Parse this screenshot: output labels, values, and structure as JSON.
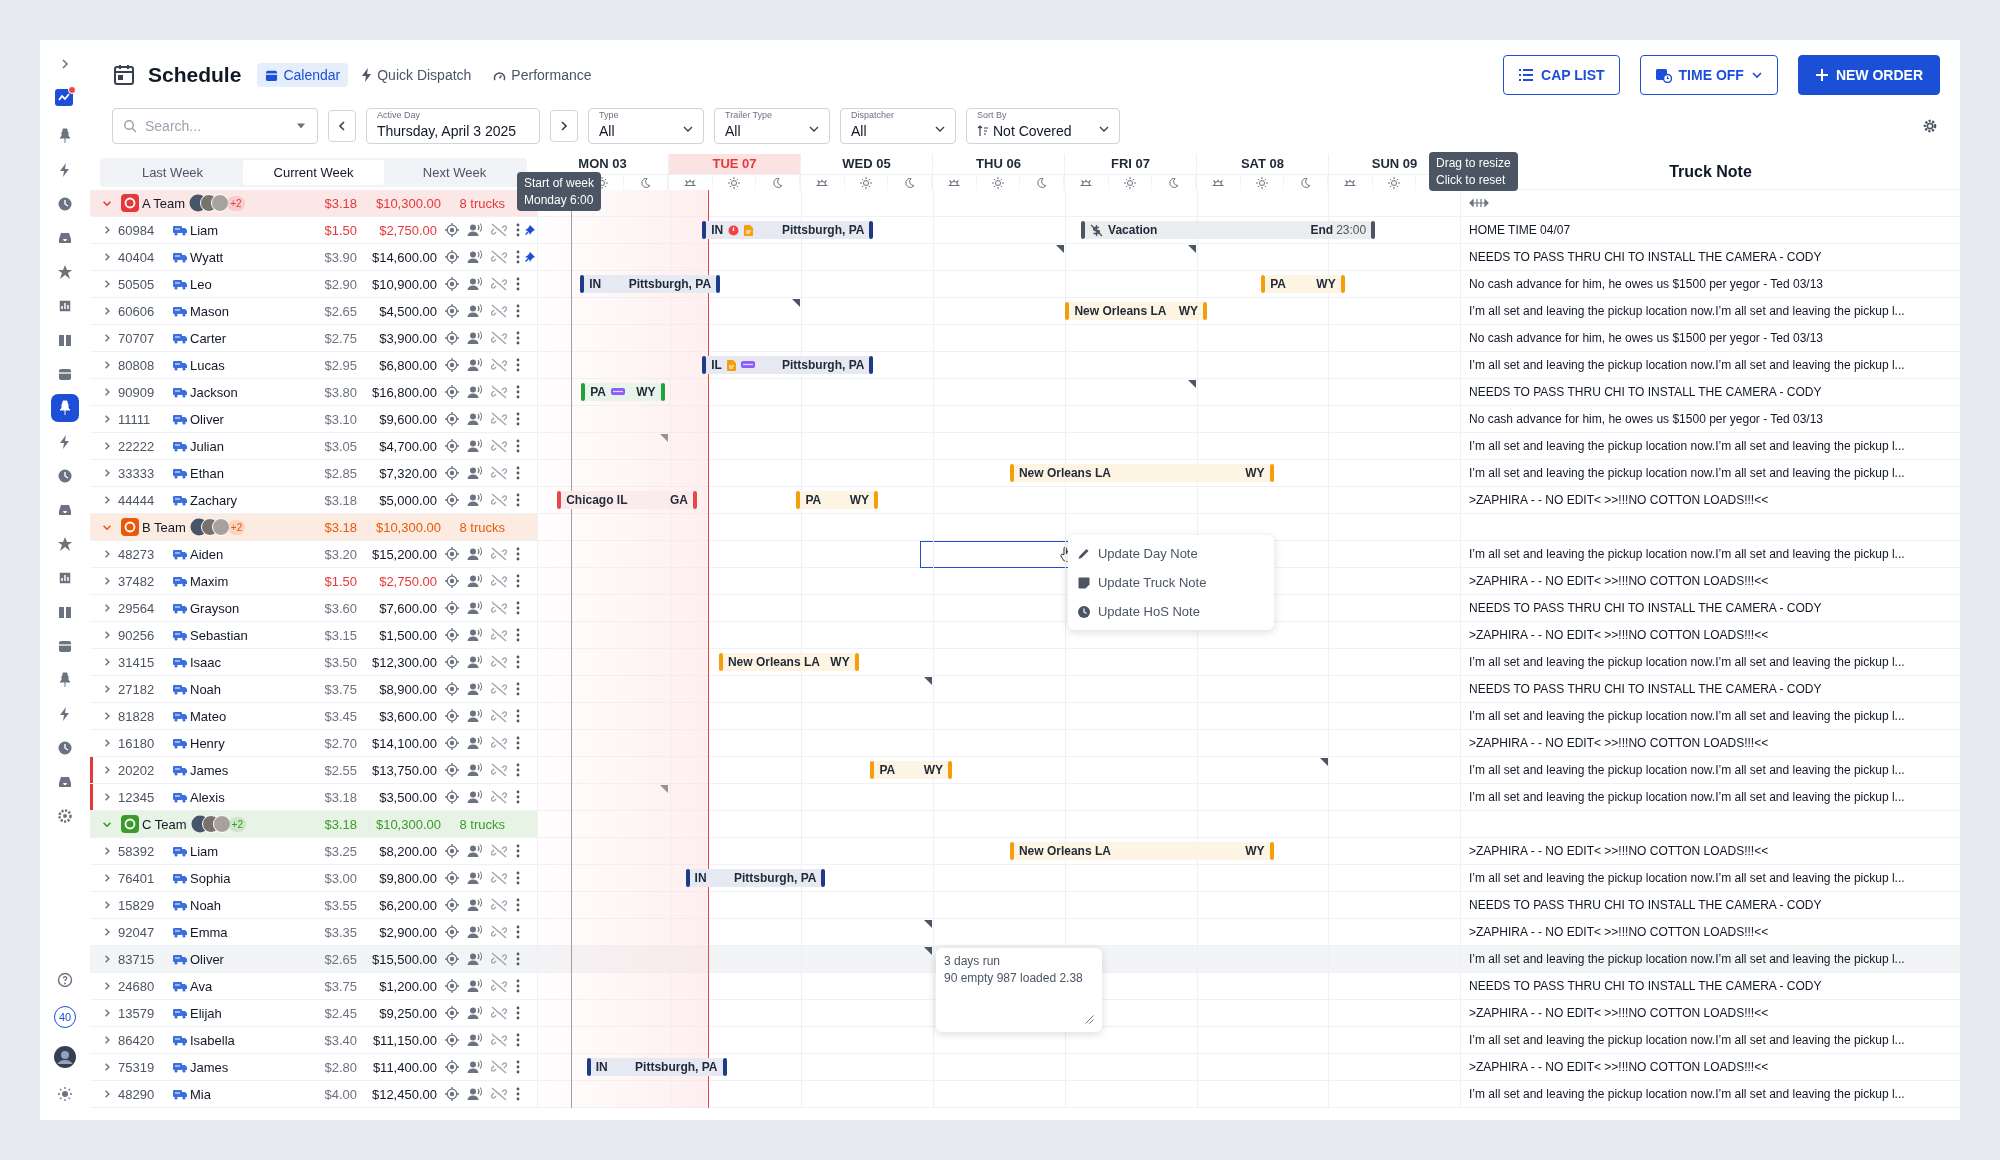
{
  "sidebar": {
    "items": [
      {
        "selected": false
      },
      {
        "selected": false
      },
      {
        "selected": false
      },
      {
        "selected": false
      },
      {
        "selected": false
      },
      {
        "selected": false
      },
      {
        "selected": false
      },
      {
        "selected": false
      },
      {
        "selected": true
      },
      {
        "selected": false
      },
      {
        "selected": false
      },
      {
        "selected": false
      },
      {
        "selected": false
      },
      {
        "selected": false
      },
      {
        "selected": false
      },
      {
        "selected": false
      },
      {
        "selected": false
      },
      {
        "selected": false
      },
      {
        "selected": false
      },
      {
        "selected": false
      },
      {
        "selected": false
      }
    ],
    "badge": "40"
  },
  "header": {
    "title": "Schedule",
    "tabs": [
      {
        "label": "Calendar",
        "selected": true,
        "kind": "calendar"
      },
      {
        "label": "Quick Dispatch",
        "selected": false,
        "kind": "bolt"
      },
      {
        "label": "Performance",
        "selected": false,
        "kind": "gauge"
      }
    ],
    "buttons": [
      {
        "label": "CAP LIST",
        "kind": "list"
      },
      {
        "label": "TIME OFF",
        "kind": "dropdown"
      },
      {
        "label": "NEW ORDER",
        "kind": "primary"
      }
    ]
  },
  "filters": {
    "search": {
      "placeholder": "Search..."
    },
    "active_day": {
      "label": "Active Day",
      "value": "Thursday, April 3 2025"
    },
    "selects": [
      {
        "label": "Type",
        "value": "All",
        "kind": "plain"
      },
      {
        "label": "Trailer Type",
        "value": "All",
        "kind": "plain"
      },
      {
        "label": "Dispatcher",
        "value": "All",
        "kind": "plain"
      },
      {
        "label": "Sort By",
        "value": "Not Covered",
        "kind": "sort"
      }
    ]
  },
  "week_tabs": [
    {
      "label": "Last Week",
      "selected": false
    },
    {
      "label": "Current Week",
      "selected": true
    },
    {
      "label": "Next Week",
      "selected": false
    }
  ],
  "days": [
    {
      "label": "MON 03",
      "today": false
    },
    {
      "label": "TUE 07",
      "today": true
    },
    {
      "label": "WED 05",
      "today": false
    },
    {
      "label": "THU 06",
      "today": false
    },
    {
      "label": "FRI 07",
      "today": false
    },
    {
      "label": "SAT 08",
      "today": false
    },
    {
      "label": "SUN 09",
      "today": false
    }
  ],
  "note_header": "Truck Note",
  "elapsed": {
    "level": 0.186
  },
  "tooltips": [
    {
      "lines": [
        "Start of week",
        "Monday 6:00"
      ]
    },
    {
      "lines": [
        "Drag to resize",
        "Click to reset"
      ]
    }
  ],
  "groups": [
    {
      "name": "A Team",
      "color": "#e5383b",
      "expanded": true,
      "extra": "+2",
      "rate": "$3.18",
      "total": "$10,300.00",
      "trucks": "8 trucks",
      "rows": [
        {
          "id": "60984",
          "name": "Liam",
          "rate": "$1.50",
          "total": "$2,750.00",
          "alert": true,
          "flagged": false,
          "pinned": true,
          "hovered": false,
          "bars": [
            {
              "kind": "load",
              "start": {
                "level": 0.181
              },
              "end": {
                "level": 0.362
              },
              "color": "#1e3a8a",
              "from": "IN",
              "to": "Pittsburgh, PA",
              "icons": [
                {
                  "kind": "alert"
                },
                {
                  "kind": "document"
                }
              ]
            },
            {
              "kind": "time_off",
              "start": {
                "level": 0.591
              },
              "end": {
                "level": 0.905
              },
              "color": "#4b5563",
              "label": "Vacation",
              "end_label": "End",
              "end_time": "23:00"
            }
          ],
          "note": "HOME TIME 04/07"
        },
        {
          "id": "40404",
          "name": "Wyatt",
          "rate": "$3.90",
          "total": "$14,600.00",
          "alert": false,
          "flagged": false,
          "pinned": true,
          "hovered": false,
          "cells": [
            {
              "kind": "empty"
            },
            {
              "kind": "empty"
            },
            {
              "kind": "empty"
            },
            {
              "kind": "note"
            },
            {
              "kind": "note"
            },
            {
              "kind": "empty"
            },
            {
              "kind": "empty"
            }
          ],
          "note": "NEEDS TO PASS THRU CHI TO INSTALL THE CAMERA - CODY"
        },
        {
          "id": "50505",
          "name": "Leo",
          "rate": "$2.90",
          "total": "$10,900.00",
          "alert": false,
          "flagged": false,
          "pinned": false,
          "hovered": false,
          "bars": [
            {
              "kind": "load",
              "start": {
                "level": 0.049
              },
              "end": {
                "level": 0.196
              },
              "color": "#1e3a8a",
              "from": "IN",
              "to": "Pittsburgh, PA"
            },
            {
              "kind": "load",
              "start": {
                "level": 0.786
              },
              "end": {
                "level": 0.872
              },
              "color": "#f59e0b",
              "from": "PA",
              "to": "WY"
            }
          ],
          "note": "No cash advance for him, he owes us $1500 per yegor - Ted 03/13"
        },
        {
          "id": "60606",
          "name": "Mason",
          "rate": "$2.65",
          "total": "$4,500.00",
          "alert": false,
          "flagged": false,
          "pinned": false,
          "hovered": false,
          "cells": [
            {
              "kind": "empty"
            },
            {
              "kind": "note"
            },
            {
              "kind": "empty"
            },
            {
              "kind": "empty"
            },
            {
              "kind": "empty"
            },
            {
              "kind": "empty"
            },
            {
              "kind": "empty"
            }
          ],
          "bars": [
            {
              "kind": "load",
              "start": {
                "level": 0.574
              },
              "end": {
                "level": 0.723
              },
              "color": "#f59e0b",
              "from": "New Orleans LA",
              "to": "WY"
            }
          ],
          "note": "I’m all set and leaving the pickup location now.I’m all set and leaving the pickup l..."
        },
        {
          "id": "70707",
          "name": "Carter",
          "rate": "$2.75",
          "total": "$3,900.00",
          "alert": false,
          "flagged": false,
          "pinned": false,
          "hovered": false,
          "note": "No cash advance for him, he owes us $1500 per yegor - Ted 03/13"
        },
        {
          "id": "80808",
          "name": "Lucas",
          "rate": "$2.95",
          "total": "$6,800.00",
          "alert": false,
          "flagged": false,
          "pinned": false,
          "hovered": false,
          "bars": [
            {
              "kind": "load",
              "start": {
                "level": 0.181
              },
              "end": {
                "level": 0.362
              },
              "color": "#1e3a8a",
              "from": "IL",
              "to": "Pittsburgh, PA",
              "icons": [
                {
                  "kind": "document"
                },
                {
                  "kind": "trailer"
                }
              ]
            }
          ],
          "note": "I’m all set and leaving the pickup location now.I’m all set and leaving the pickup l..."
        },
        {
          "id": "90909",
          "name": "Jackson",
          "rate": "$3.80",
          "total": "$16,800.00",
          "alert": false,
          "flagged": false,
          "pinned": false,
          "hovered": false,
          "cells": [
            {
              "kind": "empty"
            },
            {
              "kind": "empty"
            },
            {
              "kind": "empty"
            },
            {
              "kind": "empty"
            },
            {
              "kind": "note"
            },
            {
              "kind": "empty"
            },
            {
              "kind": "empty"
            }
          ],
          "bars": [
            {
              "kind": "load",
              "start": {
                "level": 0.05
              },
              "end": {
                "level": 0.136
              },
              "color": "#22a33a",
              "from": "PA",
              "to": "WY",
              "icons": [
                {
                  "kind": "trailer"
                }
              ]
            }
          ],
          "note": "NEEDS TO PASS THRU CHI TO INSTALL THE CAMERA - CODY"
        },
        {
          "id": "11111",
          "name": "Oliver",
          "rate": "$3.10",
          "total": "$9,600.00",
          "alert": false,
          "flagged": false,
          "pinned": false,
          "hovered": false,
          "note": "No cash advance for him, he owes us $1500 per yegor - Ted 03/13"
        },
        {
          "id": "22222",
          "name": "Julian",
          "rate": "$3.05",
          "total": "$4,700.00",
          "alert": false,
          "flagged": false,
          "pinned": false,
          "hovered": false,
          "cells": [
            {
              "kind": "note"
            },
            {
              "kind": "empty"
            },
            {
              "kind": "empty"
            },
            {
              "kind": "empty"
            },
            {
              "kind": "empty"
            },
            {
              "kind": "empty"
            },
            {
              "kind": "empty"
            }
          ],
          "note": "I’m all set and leaving the pickup location now.I’m all set and leaving the pickup l..."
        },
        {
          "id": "33333",
          "name": "Ethan",
          "rate": "$2.85",
          "total": "$7,320.00",
          "alert": false,
          "flagged": false,
          "pinned": false,
          "hovered": false,
          "bars": [
            {
              "kind": "load",
              "start": {
                "level": 0.514
              },
              "end": {
                "level": 0.795
              },
              "color": "#f59e0b",
              "from": "New Orleans LA",
              "to": "WY"
            }
          ],
          "note": "I’m all set and leaving the pickup location now.I’m all set and leaving the pickup l..."
        },
        {
          "id": "44444",
          "name": "Zachary",
          "rate": "$3.18",
          "total": "$5,000.00",
          "alert": false,
          "flagged": false,
          "pinned": false,
          "hovered": false,
          "bars": [
            {
              "kind": "load",
              "start": {
                "level": 0.024
              },
              "end": {
                "level": 0.171
              },
              "color": "#e5484d",
              "from": "Chicago IL",
              "to": "GA"
            },
            {
              "kind": "load",
              "start": {
                "level": 0.283
              },
              "end": {
                "level": 0.367
              },
              "color": "#f59e0b",
              "from": "PA",
              "to": "WY"
            }
          ],
          "note": ">ZAPHIRA - - NO EDIT< >>!!!NO COTTON LOADS!!!<<"
        }
      ]
    },
    {
      "name": "B Team",
      "color": "#e8590c",
      "expanded": true,
      "extra": "+2",
      "rate": "$3.18",
      "total": "$10,300.00",
      "trucks": "8 trucks",
      "rows": [
        {
          "id": "48273",
          "name": "Aiden",
          "rate": "$3.20",
          "total": "$15,200.00",
          "alert": false,
          "flagged": false,
          "pinned": false,
          "hovered": false,
          "cells": [
            {
              "kind": "empty"
            },
            {
              "kind": "empty"
            },
            {
              "kind": "empty"
            },
            {
              "kind": "selected"
            },
            {
              "kind": "empty"
            },
            {
              "kind": "empty"
            },
            {
              "kind": "empty"
            }
          ],
          "menu": [
            {
              "label": "Update Day Note",
              "kind": "edit"
            },
            {
              "label": "Update Truck Note",
              "kind": "note"
            },
            {
              "label": "Update HoS Note",
              "kind": "clock"
            }
          ],
          "note": "I’m all set and leaving the pickup location now.I’m all set and leaving the pickup l..."
        },
        {
          "id": "37482",
          "name": "Maxim",
          "rate": "$1.50",
          "total": "$2,750.00",
          "alert": true,
          "flagged": false,
          "pinned": false,
          "hovered": false,
          "note": ">ZAPHIRA - - NO EDIT< >>!!!NO COTTON LOADS!!!<<"
        },
        {
          "id": "29564",
          "name": "Grayson",
          "rate": "$3.60",
          "total": "$7,600.00",
          "alert": false,
          "flagged": false,
          "pinned": false,
          "hovered": false,
          "note": "NEEDS TO PASS THRU CHI TO INSTALL THE CAMERA - CODY"
        },
        {
          "id": "90256",
          "name": "Sebastian",
          "rate": "$3.15",
          "total": "$1,500.00",
          "alert": false,
          "flagged": false,
          "pinned": false,
          "hovered": false,
          "note": ">ZAPHIRA - - NO EDIT< >>!!!NO COTTON LOADS!!!<<"
        },
        {
          "id": "31415",
          "name": "Isaac",
          "rate": "$3.50",
          "total": "$12,300.00",
          "alert": false,
          "flagged": false,
          "pinned": false,
          "hovered": false,
          "bars": [
            {
              "kind": "load",
              "start": {
                "level": 0.199
              },
              "end": {
                "level": 0.346
              },
              "color": "#f59e0b",
              "from": "New Orleans LA",
              "to": "WY"
            }
          ],
          "note": "I’m all set and leaving the pickup location now.I’m all set and leaving the pickup l..."
        },
        {
          "id": "27182",
          "name": "Noah",
          "rate": "$3.75",
          "total": "$8,900.00",
          "alert": false,
          "flagged": false,
          "pinned": false,
          "hovered": false,
          "cells": [
            {
              "kind": "empty"
            },
            {
              "kind": "empty"
            },
            {
              "kind": "note"
            },
            {
              "kind": "empty"
            },
            {
              "kind": "empty"
            },
            {
              "kind": "empty"
            },
            {
              "kind": "empty"
            }
          ],
          "note": "NEEDS TO PASS THRU CHI TO INSTALL THE CAMERA - CODY"
        },
        {
          "id": "81828",
          "name": "Mateo",
          "rate": "$3.45",
          "total": "$3,600.00",
          "alert": false,
          "flagged": false,
          "pinned": false,
          "hovered": false,
          "note": "I’m all set and leaving the pickup location now.I’m all set and leaving the pickup l..."
        },
        {
          "id": "16180",
          "name": "Henry",
          "rate": "$2.70",
          "total": "$14,100.00",
          "alert": false,
          "flagged": false,
          "pinned": false,
          "hovered": false,
          "note": ">ZAPHIRA - - NO EDIT< >>!!!NO COTTON LOADS!!!<<"
        },
        {
          "id": "20202",
          "name": "James",
          "rate": "$2.55",
          "total": "$13,750.00",
          "alert": false,
          "flagged": true,
          "pinned": false,
          "hovered": false,
          "cells": [
            {
              "kind": "empty"
            },
            {
              "kind": "empty"
            },
            {
              "kind": "empty"
            },
            {
              "kind": "empty"
            },
            {
              "kind": "empty"
            },
            {
              "kind": "note"
            },
            {
              "kind": "empty"
            }
          ],
          "bars": [
            {
              "kind": "load",
              "start": {
                "level": 0.363
              },
              "end": {
                "level": 0.447
              },
              "color": "#f59e0b",
              "from": "PA",
              "to": "WY"
            }
          ],
          "note": "I’m all set and leaving the pickup location now.I’m all set and leaving the pickup l..."
        },
        {
          "id": "12345",
          "name": "Alexis",
          "rate": "$3.18",
          "total": "$3,500.00",
          "alert": false,
          "flagged": true,
          "pinned": false,
          "hovered": false,
          "cells": [
            {
              "kind": "note"
            },
            {
              "kind": "empty"
            },
            {
              "kind": "empty"
            },
            {
              "kind": "empty"
            },
            {
              "kind": "empty"
            },
            {
              "kind": "empty"
            },
            {
              "kind": "empty"
            }
          ],
          "note": "I’m all set and leaving the pickup location now.I’m all set and leaving the pickup l..."
        }
      ]
    },
    {
      "name": "C Team",
      "color": "#3a9a2a",
      "expanded": true,
      "extra": "+2",
      "rate": "$3.18",
      "total": "$10,300.00",
      "trucks": "8 trucks",
      "rows": [
        {
          "id": "58392",
          "name": "Liam",
          "rate": "$3.25",
          "total": "$8,200.00",
          "alert": false,
          "flagged": false,
          "pinned": false,
          "hovered": false,
          "bars": [
            {
              "kind": "load",
              "start": {
                "level": 0.514
              },
              "end": {
                "level": 0.795
              },
              "color": "#f59e0b",
              "from": "New Orleans LA",
              "to": "WY"
            }
          ],
          "note": ">ZAPHIRA - - NO EDIT< >>!!!NO COTTON LOADS!!!<<"
        },
        {
          "id": "76401",
          "name": "Sophia",
          "rate": "$3.00",
          "total": "$9,800.00",
          "alert": false,
          "flagged": false,
          "pinned": false,
          "hovered": false,
          "bars": [
            {
              "kind": "load",
              "start": {
                "level": 0.163
              },
              "end": {
                "level": 0.31
              },
              "color": "#1e3a8a",
              "from": "IN",
              "to": "Pittsburgh, PA"
            }
          ],
          "note": "I’m all set and leaving the pickup location now.I’m all set and leaving the pickup l..."
        },
        {
          "id": "15829",
          "name": "Noah",
          "rate": "$3.55",
          "total": "$6,200.00",
          "alert": false,
          "flagged": false,
          "pinned": false,
          "hovered": false,
          "note": "NEEDS TO PASS THRU CHI TO INSTALL THE CAMERA - CODY"
        },
        {
          "id": "92047",
          "name": "Emma",
          "rate": "$3.35",
          "total": "$2,900.00",
          "alert": false,
          "flagged": false,
          "pinned": false,
          "hovered": false,
          "cells": [
            {
              "kind": "empty"
            },
            {
              "kind": "empty"
            },
            {
              "kind": "note"
            },
            {
              "kind": "empty"
            },
            {
              "kind": "empty"
            },
            {
              "kind": "empty"
            },
            {
              "kind": "empty"
            }
          ],
          "note": ">ZAPHIRA - - NO EDIT< >>!!!NO COTTON LOADS!!!<<"
        },
        {
          "id": "83715",
          "name": "Oliver",
          "rate": "$2.65",
          "total": "$15,500.00",
          "alert": false,
          "flagged": false,
          "pinned": false,
          "hovered": true,
          "cells": [
            {
              "kind": "empty"
            },
            {
              "kind": "empty"
            },
            {
              "kind": "note"
            },
            {
              "kind": "empty"
            },
            {
              "kind": "empty"
            },
            {
              "kind": "empty"
            },
            {
              "kind": "empty"
            }
          ],
          "popup": {
            "lines": [
              "3 days run",
              "90 empty 987 loaded 2.38"
            ]
          },
          "note": "I’m all set and leaving the pickup location now.I’m all set and leaving the pickup l..."
        },
        {
          "id": "24680",
          "name": "Ava",
          "rate": "$3.75",
          "total": "$1,200.00",
          "alert": false,
          "flagged": false,
          "pinned": false,
          "hovered": false,
          "note": "NEEDS TO PASS THRU CHI TO INSTALL THE CAMERA - CODY"
        },
        {
          "id": "13579",
          "name": "Elijah",
          "rate": "$2.45",
          "total": "$9,250.00",
          "alert": false,
          "flagged": false,
          "pinned": false,
          "hovered": false,
          "note": ">ZAPHIRA - - NO EDIT< >>!!!NO COTTON LOADS!!!<<"
        },
        {
          "id": "86420",
          "name": "Isabella",
          "rate": "$3.40",
          "total": "$11,150.00",
          "alert": false,
          "flagged": false,
          "pinned": false,
          "hovered": false,
          "note": "I’m all set and leaving the pickup location now.I’m all set and leaving the pickup l..."
        },
        {
          "id": "75319",
          "name": "James",
          "rate": "$2.80",
          "total": "$11,400.00",
          "alert": false,
          "flagged": false,
          "pinned": false,
          "hovered": false,
          "bars": [
            {
              "kind": "load",
              "start": {
                "level": 0.056
              },
              "end": {
                "level": 0.203
              },
              "color": "#1e3a8a",
              "from": "IN",
              "to": "Pittsburgh, PA"
            }
          ],
          "note": ">ZAPHIRA - - NO EDIT< >>!!!NO COTTON LOADS!!!<<"
        },
        {
          "id": "48290",
          "name": "Mia",
          "rate": "$4.00",
          "total": "$12,450.00",
          "alert": false,
          "flagged": false,
          "pinned": false,
          "hovered": false,
          "note": "I’m all set and leaving the pickup location now.I’m all set and leaving the pickup l..."
        }
      ]
    }
  ]
}
